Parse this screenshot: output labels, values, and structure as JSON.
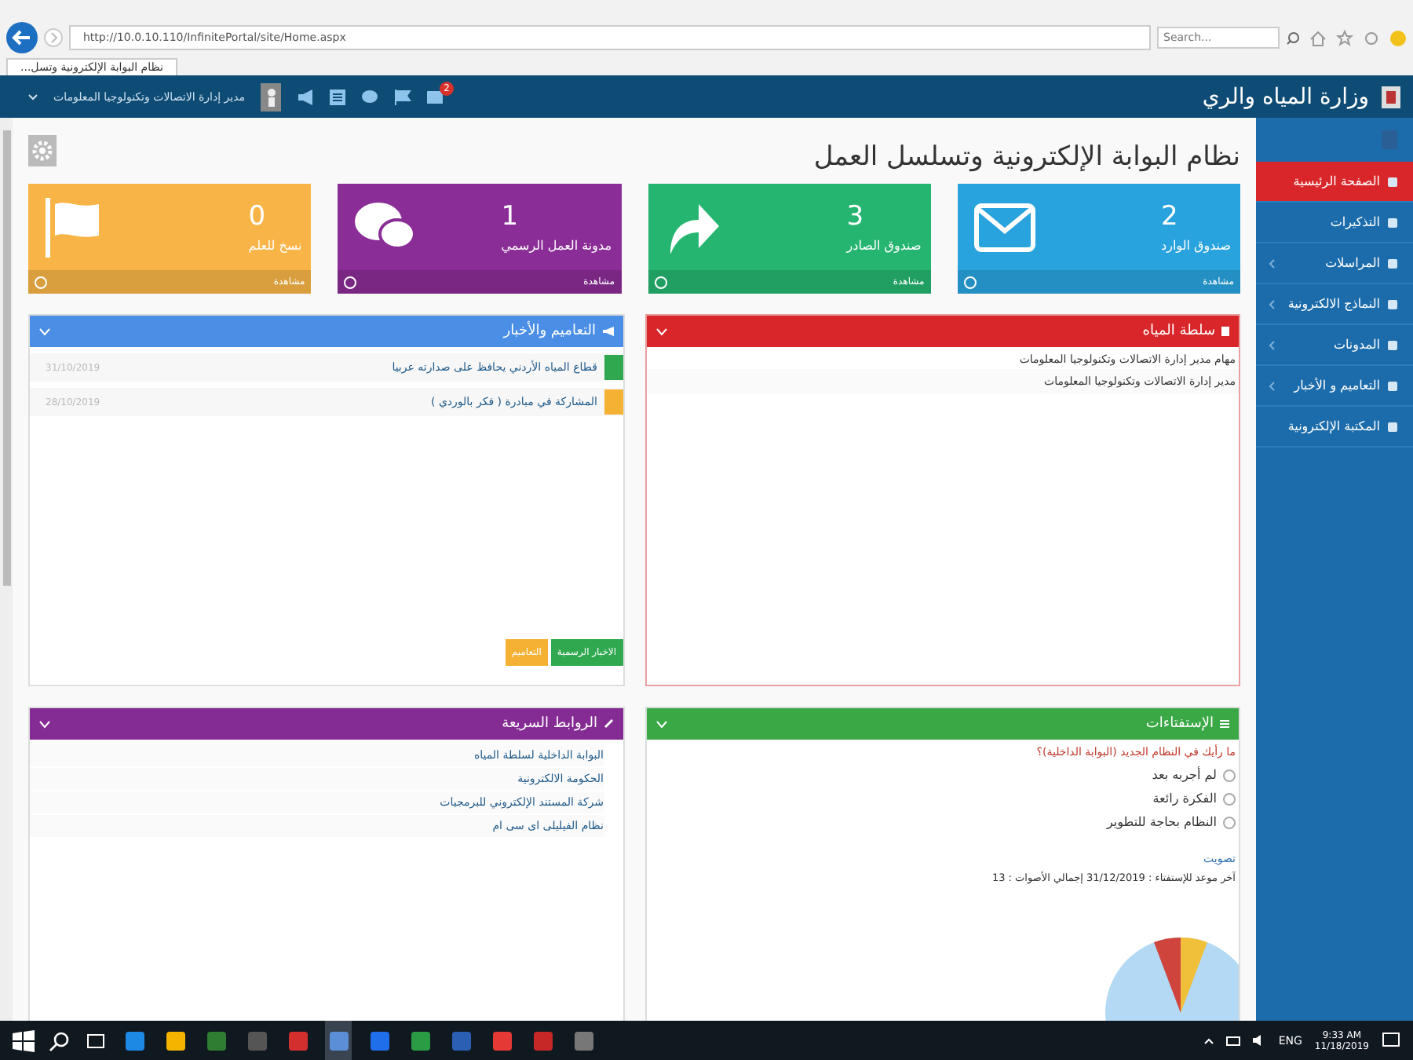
{
  "browser": {
    "url": "http://10.0.10.110/InfinitePortal/site/Home.aspx",
    "search": {
      "placeholder": "Search..."
    },
    "tab_title": "نظام البوابة الإلكترونية وتسل..."
  },
  "header": {
    "title": "وزارة المياه والري",
    "user": "مدير إدارة الاتصالات وتكنولوجيا المعلومات",
    "notification_count": "2"
  },
  "sidebar": {
    "items": [
      {
        "label": "الصفحة الرئيسية",
        "selected": true,
        "expandable": false
      },
      {
        "label": "التذكيرات",
        "selected": false,
        "expandable": false
      },
      {
        "label": "المراسلات",
        "selected": false,
        "expandable": true
      },
      {
        "label": "النماذج الالكترونية",
        "selected": false,
        "expandable": true
      },
      {
        "label": "المدونات",
        "selected": false,
        "expandable": true
      },
      {
        "label": "التعاميم و الأخبار",
        "selected": false,
        "expandable": true
      },
      {
        "label": "المكتبة الإلكترونية",
        "selected": false,
        "expandable": false
      }
    ]
  },
  "page_title": "نظام البوابة الإلكترونية وتسلسل العمل",
  "tiles": [
    {
      "count": "2",
      "label": "صندوق الوارد",
      "footer": "مشاهدة",
      "color": "#29a3dd"
    },
    {
      "count": "3",
      "label": "صندوق الصادر",
      "footer": "مشاهدة",
      "color": "#26b571"
    },
    {
      "count": "1",
      "label": "مدونة العمل الرسمي",
      "footer": "مشاهدة",
      "color": "#8a2d96"
    },
    {
      "count": "0",
      "label": "نسخ للعلم",
      "footer": "مشاهدة",
      "color": "#f8b446"
    }
  ],
  "authority_panel": {
    "title": "سلطة المياه",
    "items": [
      "مهام مدير إدارة الاتصالات وتكنولوجيا المعلومات",
      "مدير إدارة الاتصالات وتكنولوجيا المعلومات"
    ]
  },
  "news_panel": {
    "title": "التعاميم والأخبار",
    "items": [
      {
        "text": "قطاع المياه الأردني يحافظ على صدارته عربيا",
        "date": "31/10/2019",
        "color": "#2fa84f"
      },
      {
        "text": "المشاركة في مبادرة ( فكر بالوردي )",
        "date": "28/10/2019",
        "color": "#f5b133"
      }
    ],
    "buttons": [
      {
        "label": "الاخبار الرسمية",
        "color": "#2fa84f"
      },
      {
        "label": "التعاميم",
        "color": "#f5b133"
      }
    ]
  },
  "polls_panel": {
    "title": "الإستفتاءات",
    "question": "ما رأيك في النظام الجديد (البوابة الداخلية)؟",
    "options": [
      {
        "label": "لم أجربه بعد",
        "selected": false
      },
      {
        "label": "الفكرة رائعة",
        "selected": false
      },
      {
        "label": "النظام بحاجة للتطوير",
        "selected": false
      }
    ],
    "vote_link": "تصويت",
    "deadline": "آخر موعد للإستفتاء : 31/12/2019 إجمالي الأصوات : 13"
  },
  "quick_links_panel": {
    "title": "الروابط السريعة",
    "links": [
      "البوابة الداخلية لسلطة المياه",
      "الحكومة الالكترونية",
      "شركة المستند الإلكتروني للبرمجيات",
      "نظام الفيليلى اى سى ام"
    ]
  },
  "taskbar": {
    "language": "ENG",
    "time": "9:33 AM",
    "date": "11/18/2019"
  }
}
